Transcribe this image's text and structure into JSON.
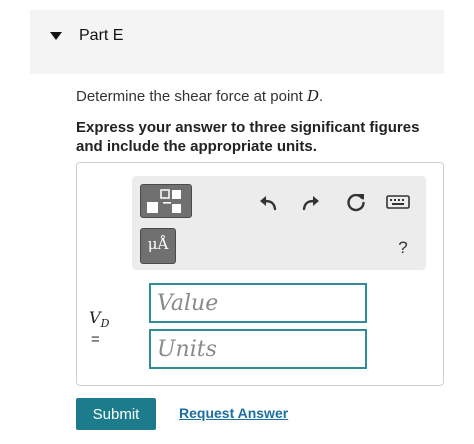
{
  "part": {
    "title": "Part E"
  },
  "question": {
    "text": "Determine the shear force at point ",
    "point": "D",
    "period": "."
  },
  "instructions": "Express your answer to three significant figures and include the appropriate units.",
  "toolbar": {
    "units_label": "μÅ",
    "help_label": "?",
    "icons": [
      "templates-icon",
      "units-icon",
      "undo-icon",
      "redo-icon",
      "reset-icon",
      "keyboard-icon",
      "help-icon"
    ]
  },
  "answer": {
    "variable": "V",
    "subscript": "D",
    "equals": "=",
    "value_placeholder": "Value",
    "units_placeholder": "Units"
  },
  "actions": {
    "submit_label": "Submit",
    "request_label": "Request Answer"
  },
  "colors": {
    "accent": "#1c7c8c",
    "field_border": "#2e8d97",
    "link": "#1c6fa0"
  }
}
